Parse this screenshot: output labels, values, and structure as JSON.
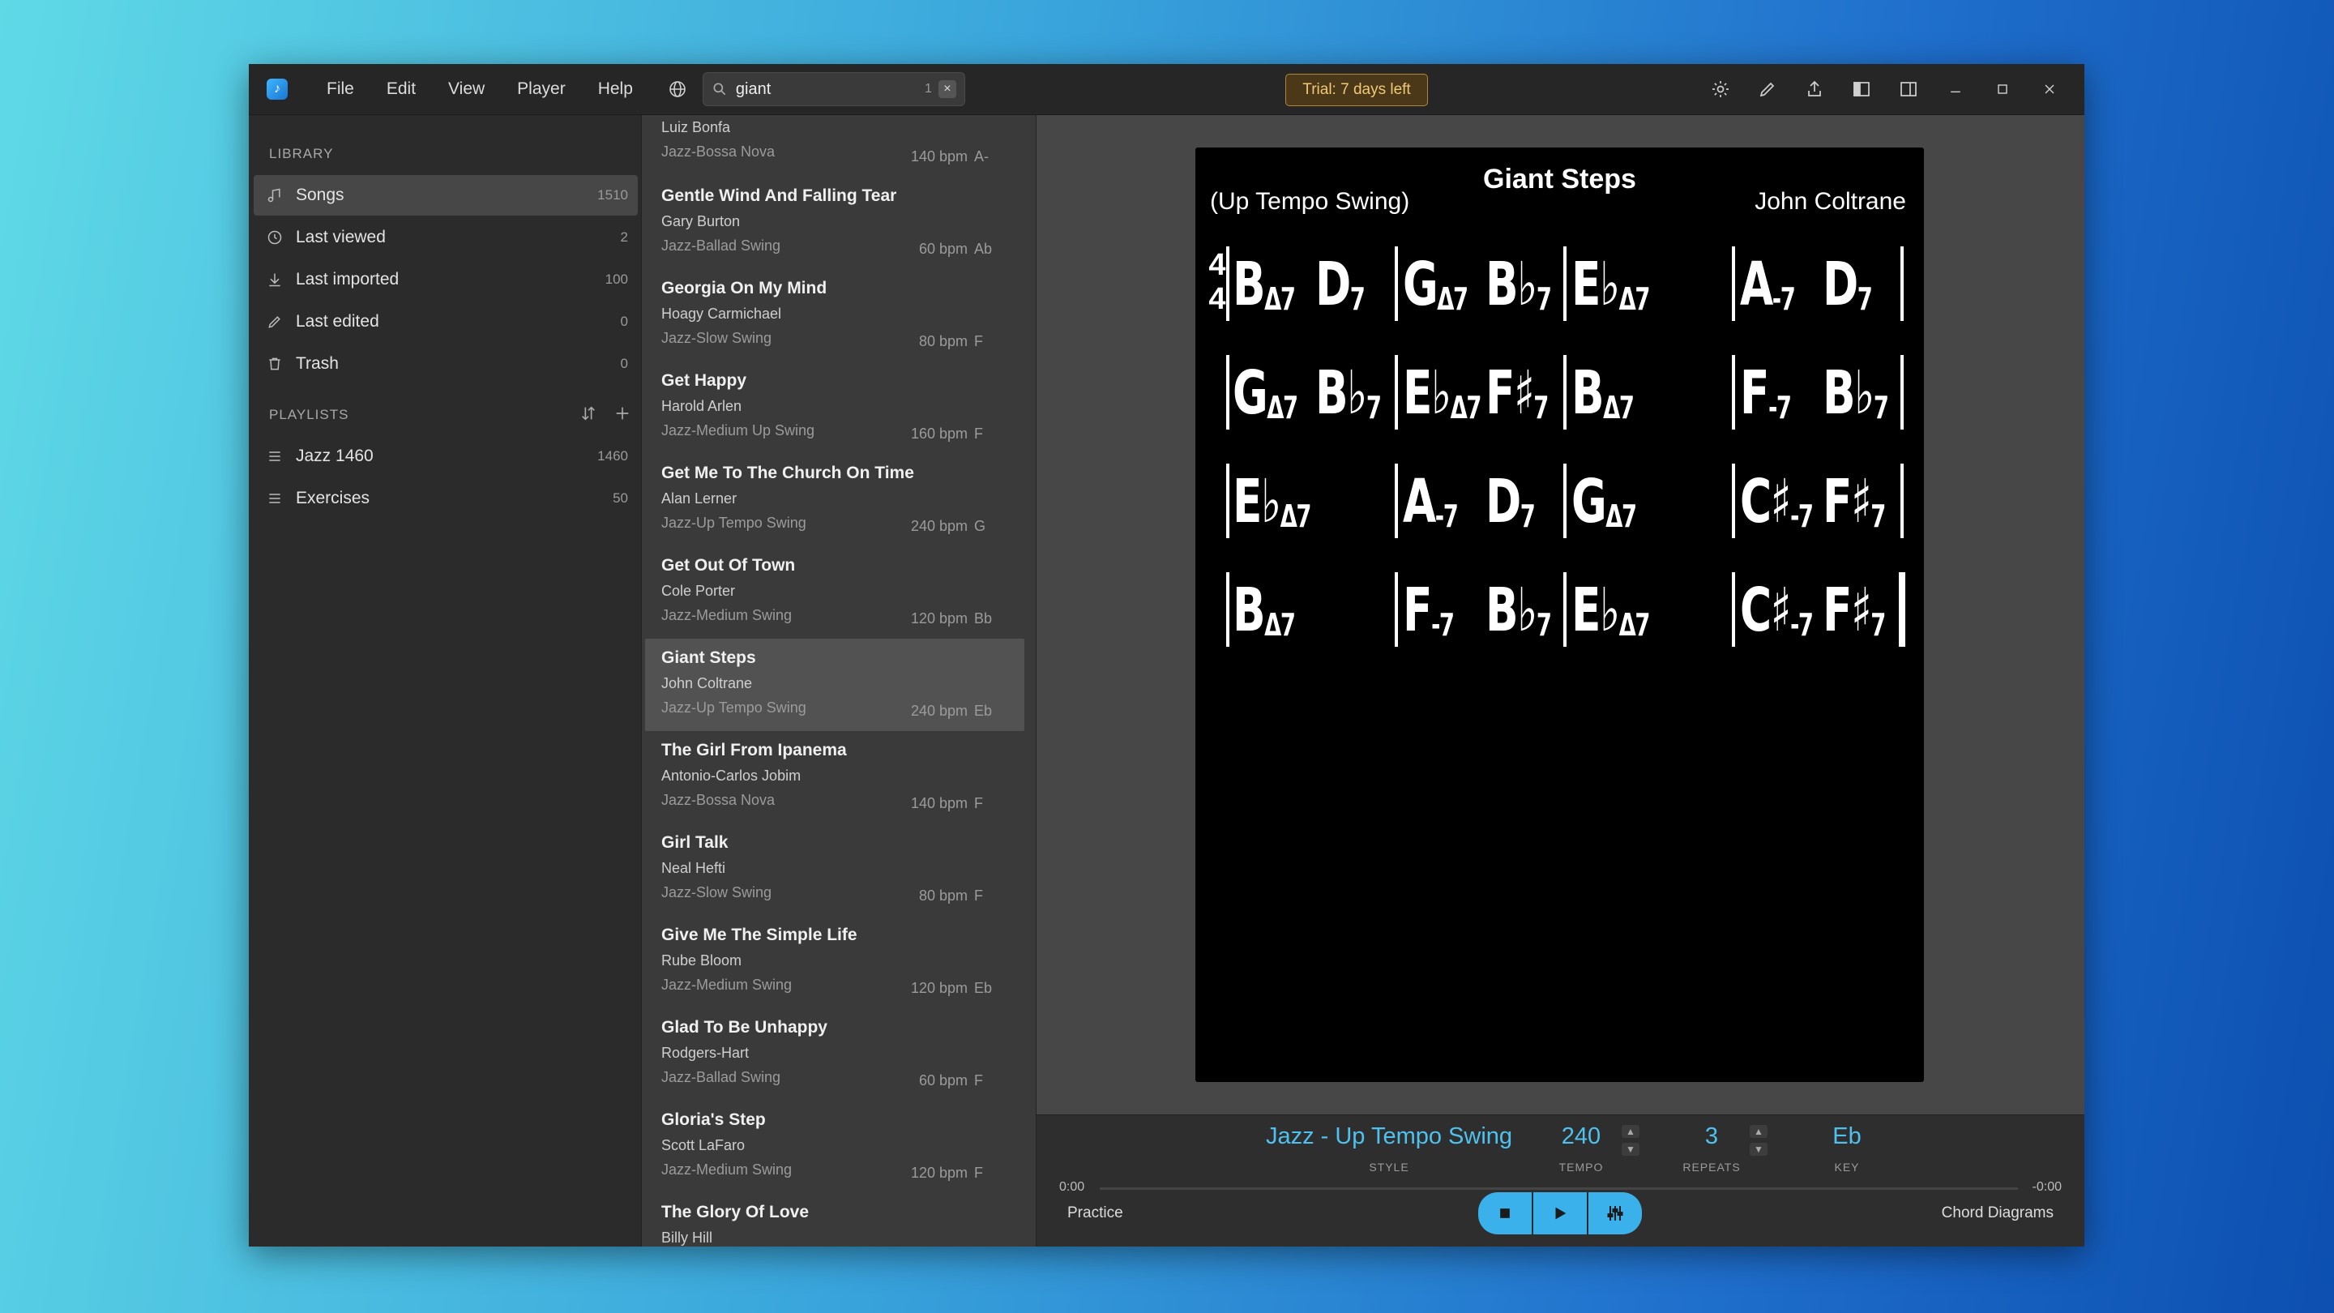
{
  "menu": [
    "File",
    "Edit",
    "View",
    "Player",
    "Help"
  ],
  "search": {
    "value": "giant",
    "count": "1"
  },
  "trial_label": "Trial: 7 days left",
  "sidebar": {
    "library_title": "LIBRARY",
    "items": [
      {
        "label": "Songs",
        "count": "1510",
        "icon": "music-note-icon"
      },
      {
        "label": "Last viewed",
        "count": "2",
        "icon": "clock-icon"
      },
      {
        "label": "Last imported",
        "count": "100",
        "icon": "download-icon"
      },
      {
        "label": "Last edited",
        "count": "0",
        "icon": "pencil-icon"
      },
      {
        "label": "Trash",
        "count": "0",
        "icon": "trash-icon"
      }
    ],
    "playlists_title": "PLAYLISTS",
    "playlists": [
      {
        "label": "Jazz 1460",
        "count": "1460"
      },
      {
        "label": "Exercises",
        "count": "50"
      }
    ]
  },
  "songs": [
    {
      "title": "",
      "artist": "Luiz Bonfa",
      "style": "Jazz-Bossa Nova",
      "bpm": "140 bpm",
      "key": "A-"
    },
    {
      "title": "Gentle Wind And Falling Tear",
      "artist": "Gary Burton",
      "style": "Jazz-Ballad Swing",
      "bpm": "60 bpm",
      "key": "Ab"
    },
    {
      "title": "Georgia On My Mind",
      "artist": "Hoagy Carmichael",
      "style": "Jazz-Slow Swing",
      "bpm": "80 bpm",
      "key": "F"
    },
    {
      "title": "Get Happy",
      "artist": "Harold Arlen",
      "style": "Jazz-Medium Up Swing",
      "bpm": "160 bpm",
      "key": "F"
    },
    {
      "title": "Get Me To The Church On Time",
      "artist": "Alan Lerner",
      "style": "Jazz-Up Tempo Swing",
      "bpm": "240 bpm",
      "key": "G"
    },
    {
      "title": "Get Out Of Town",
      "artist": "Cole Porter",
      "style": "Jazz-Medium Swing",
      "bpm": "120 bpm",
      "key": "Bb"
    },
    {
      "title": "Giant Steps",
      "artist": "John Coltrane",
      "style": "Jazz-Up Tempo Swing",
      "bpm": "240 bpm",
      "key": "Eb"
    },
    {
      "title": "The Girl From Ipanema",
      "artist": "Antonio-Carlos Jobim",
      "style": "Jazz-Bossa Nova",
      "bpm": "140 bpm",
      "key": "F"
    },
    {
      "title": "Girl Talk",
      "artist": "Neal Hefti",
      "style": "Jazz-Slow Swing",
      "bpm": "80 bpm",
      "key": "F"
    },
    {
      "title": "Give Me The Simple Life",
      "artist": "Rube Bloom",
      "style": "Jazz-Medium Swing",
      "bpm": "120 bpm",
      "key": "Eb"
    },
    {
      "title": "Glad To Be Unhappy",
      "artist": "Rodgers-Hart",
      "style": "Jazz-Ballad Swing",
      "bpm": "60 bpm",
      "key": "F"
    },
    {
      "title": "Gloria's Step",
      "artist": "Scott LaFaro",
      "style": "Jazz-Medium Swing",
      "bpm": "120 bpm",
      "key": "F"
    },
    {
      "title": "The Glory Of Love",
      "artist": "Billy Hill",
      "style": "",
      "bpm": "",
      "key": ""
    }
  ],
  "sheet": {
    "title": "Giant Steps",
    "style": "(Up Tempo Swing)",
    "composer": "John Coltrane",
    "time_signature": [
      "4",
      "4"
    ],
    "rows": [
      [
        "BΔ7",
        "D7",
        "GΔ7",
        "B♭7",
        "E♭Δ7",
        "A-7",
        "D7"
      ],
      [
        "GΔ7",
        "B♭7",
        "E♭Δ7",
        "F♯7",
        "BΔ7",
        "F-7",
        "B♭7"
      ],
      [
        "E♭Δ7",
        "A-7",
        "D7",
        "GΔ7",
        "C♯-7",
        "F♯7"
      ],
      [
        "BΔ7",
        "F-7",
        "B♭7",
        "E♭Δ7",
        "C♯-7",
        "F♯7"
      ]
    ]
  },
  "player": {
    "style_value": "Jazz - Up Tempo Swing",
    "style_label": "STYLE",
    "tempo_value": "240",
    "tempo_label": "TEMPO",
    "repeats_value": "3",
    "repeats_label": "REPEATS",
    "key_value": "Eb",
    "key_label": "KEY",
    "time_start": "0:00",
    "time_end": "-0:00",
    "practice_label": "Practice",
    "chord_diagrams_label": "Chord Diagrams"
  },
  "colors": {
    "accent": "#3ab1ea",
    "trial_border": "#b08838"
  }
}
